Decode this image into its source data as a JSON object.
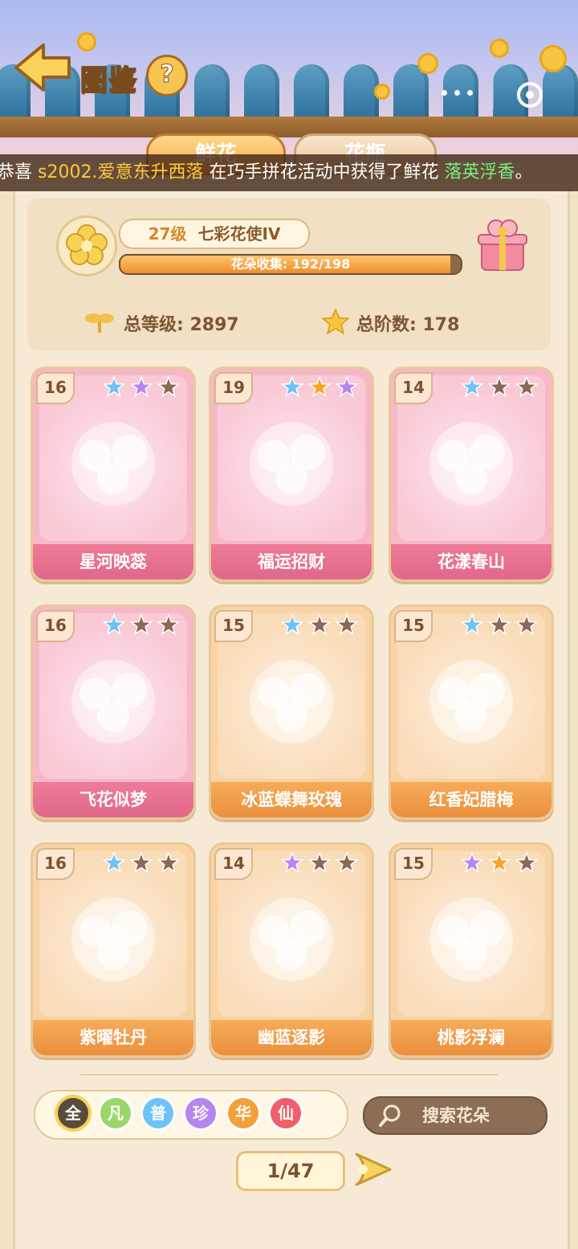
{
  "header": {
    "title": "图鉴",
    "help": "?"
  },
  "tabs": [
    {
      "label": "鲜花",
      "active": true
    },
    {
      "label": "花瓶",
      "active": false
    }
  ],
  "ticker": {
    "prefix": "恭喜",
    "user": "s2002.爱意东升西落",
    "middle": "在巧手拼花活动中获得了鲜花",
    "flower": "落英浮香",
    "suffix": "。"
  },
  "summary": {
    "level": "27级",
    "rank": "七彩花使IV",
    "progress_label": "花朵收集: 192/198",
    "progress_fraction": 0.9697,
    "total_level_label": "总等级: 2897",
    "total_stars_label": "总阶数: 178"
  },
  "cards": [
    {
      "level": "16",
      "name": "星河映蕊",
      "theme": "pink",
      "stars": [
        "#6ec3f4",
        "#b686f0",
        "#8a6a55"
      ]
    },
    {
      "level": "19",
      "name": "福运招财",
      "theme": "pink",
      "stars": [
        "#6ec3f4",
        "#f5a623",
        "#b686f0"
      ]
    },
    {
      "level": "14",
      "name": "花漾春山",
      "theme": "pink",
      "stars": [
        "#6ec3f4",
        "#8a6a55",
        "#8a6a55"
      ]
    },
    {
      "level": "16",
      "name": "飞花似梦",
      "theme": "pink",
      "stars": [
        "#6ec3f4",
        "#8a6a55",
        "#8a6a55"
      ]
    },
    {
      "level": "15",
      "name": "冰蓝蝶舞玫瑰",
      "theme": "orange",
      "stars": [
        "#6ec3f4",
        "#8a6a55",
        "#8a6a55"
      ]
    },
    {
      "level": "15",
      "name": "红香妃腊梅",
      "theme": "orange",
      "stars": [
        "#6ec3f4",
        "#8a6a55",
        "#8a6a55"
      ]
    },
    {
      "level": "16",
      "name": "紫曜牡丹",
      "theme": "orange",
      "stars": [
        "#6ec3f4",
        "#8a6a55",
        "#8a6a55"
      ]
    },
    {
      "level": "14",
      "name": "幽蓝逐影",
      "theme": "orange",
      "stars": [
        "#b686f0",
        "#8a6a55",
        "#8a6a55"
      ]
    },
    {
      "level": "15",
      "name": "桃影浮澜",
      "theme": "orange",
      "stars": [
        "#b686f0",
        "#f5a623",
        "#8a6a55"
      ]
    }
  ],
  "filters": [
    {
      "label": "全",
      "color": "#5a4a3c",
      "selected": true
    },
    {
      "label": "凡",
      "color": "#9bd66a",
      "selected": false
    },
    {
      "label": "普",
      "color": "#6ec3f4",
      "selected": false
    },
    {
      "label": "珍",
      "color": "#b686f0",
      "selected": false
    },
    {
      "label": "华",
      "color": "#f2a13a",
      "selected": false
    },
    {
      "label": "仙",
      "color": "#ef5e6a",
      "selected": false
    }
  ],
  "search": {
    "label": "搜索花朵"
  },
  "pager": {
    "label": "1/47"
  }
}
